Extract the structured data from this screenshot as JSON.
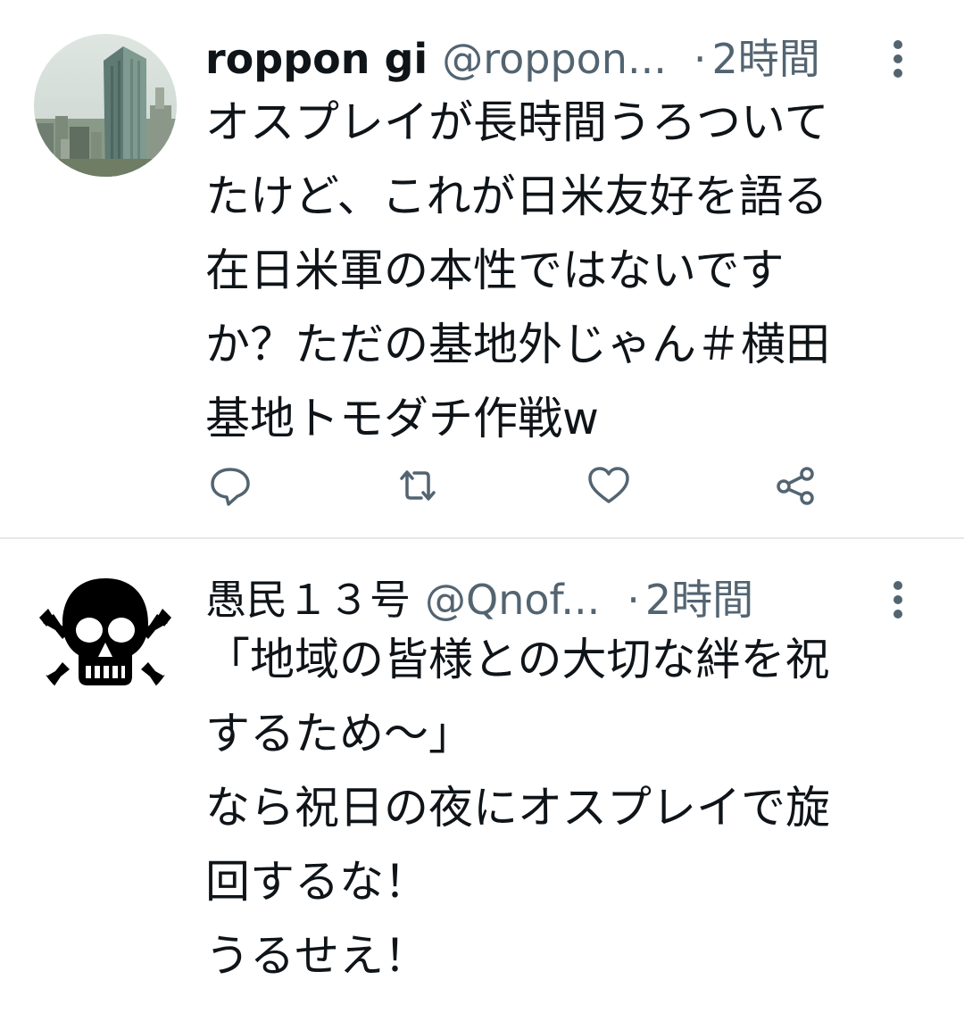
{
  "tweets": [
    {
      "display_name": "roppon gi",
      "handle": "@roppon...",
      "separator": "·",
      "time": "2時間",
      "avatar_icon": "city-skyline-avatar",
      "text": "オスプレイが長時間うろついて\nたけど、これが日米友好を語る\n在日米軍の本性ではないです\nか？ただの基地外じゃん＃横田\n基地トモダチ作戦w",
      "actions": [
        "reply-icon",
        "retweet-icon",
        "like-icon",
        "share-icon"
      ]
    },
    {
      "display_name": "愚民１３号",
      "handle": "@Qnof...",
      "separator": "·",
      "time": "2時間",
      "avatar_icon": "skull-crossbones-avatar",
      "text": "「地域の皆様との大切な絆を祝\nするため～」\nなら祝日の夜にオスプレイで旋\n回するな！\nうるせえ！"
    }
  ],
  "colors": {
    "text_primary": "#0f1419",
    "text_secondary": "#536471",
    "divider": "#e4e8eb",
    "icon": "#536471"
  }
}
